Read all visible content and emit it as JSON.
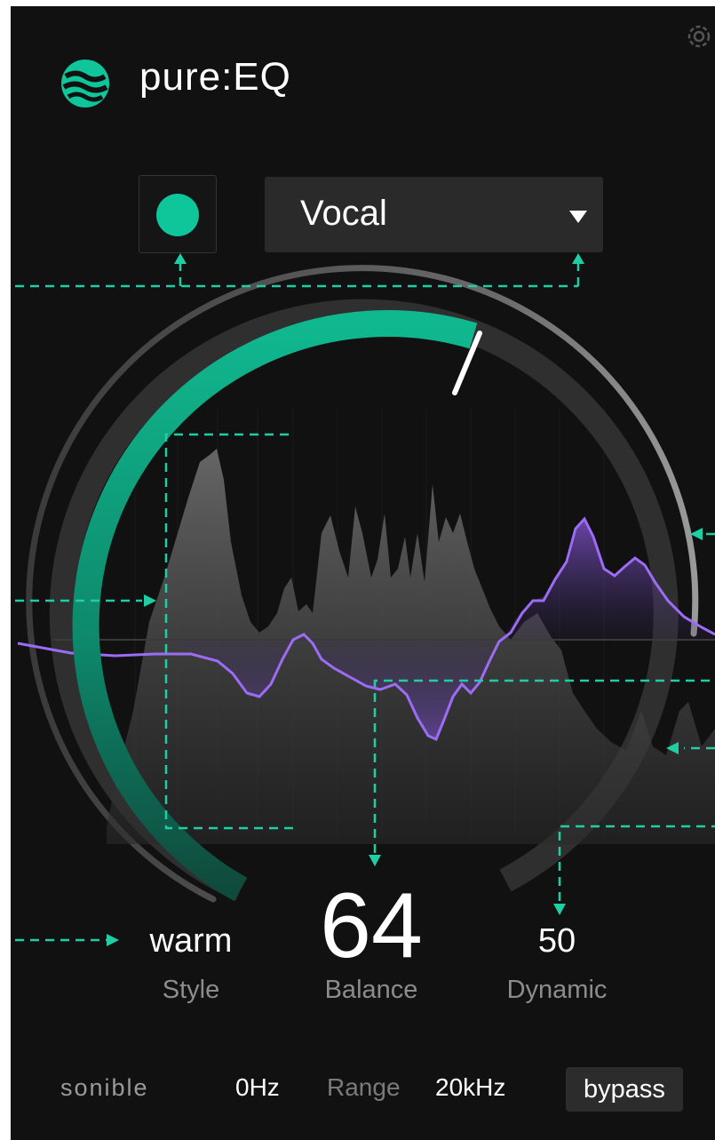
{
  "app": {
    "title": "pure:EQ",
    "brand": "sonible",
    "accent_color": "#0ec69a",
    "curve_color": "#9b6cf5"
  },
  "header": {
    "settings_icon": "gear-icon"
  },
  "preset": {
    "enabled": true,
    "selected": "Vocal"
  },
  "controls": {
    "style": {
      "value": "warm",
      "label": "Style"
    },
    "balance": {
      "value": "64",
      "label": "Balance"
    },
    "dynamic": {
      "value": "50",
      "label": "Dynamic"
    }
  },
  "footer": {
    "brand": "sonible",
    "range_low": "0Hz",
    "range_label": "Range",
    "range_high": "20kHz",
    "bypass_label": "bypass"
  }
}
